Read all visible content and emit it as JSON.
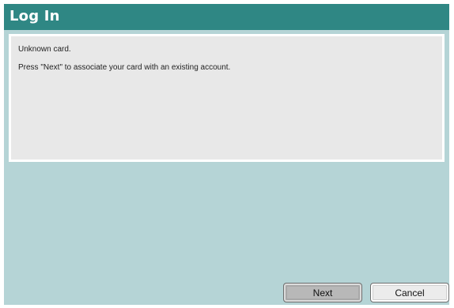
{
  "header": {
    "title": "Log In"
  },
  "message": {
    "line1": "Unknown card.",
    "line2": "Press \"Next\" to associate your card with an existing account."
  },
  "buttons": {
    "next_label": "Next",
    "cancel_label": "Cancel"
  },
  "colors": {
    "header_bg": "#2f8784",
    "body_bg": "#b5d4d6",
    "panel_bg": "#e8e8e8"
  }
}
